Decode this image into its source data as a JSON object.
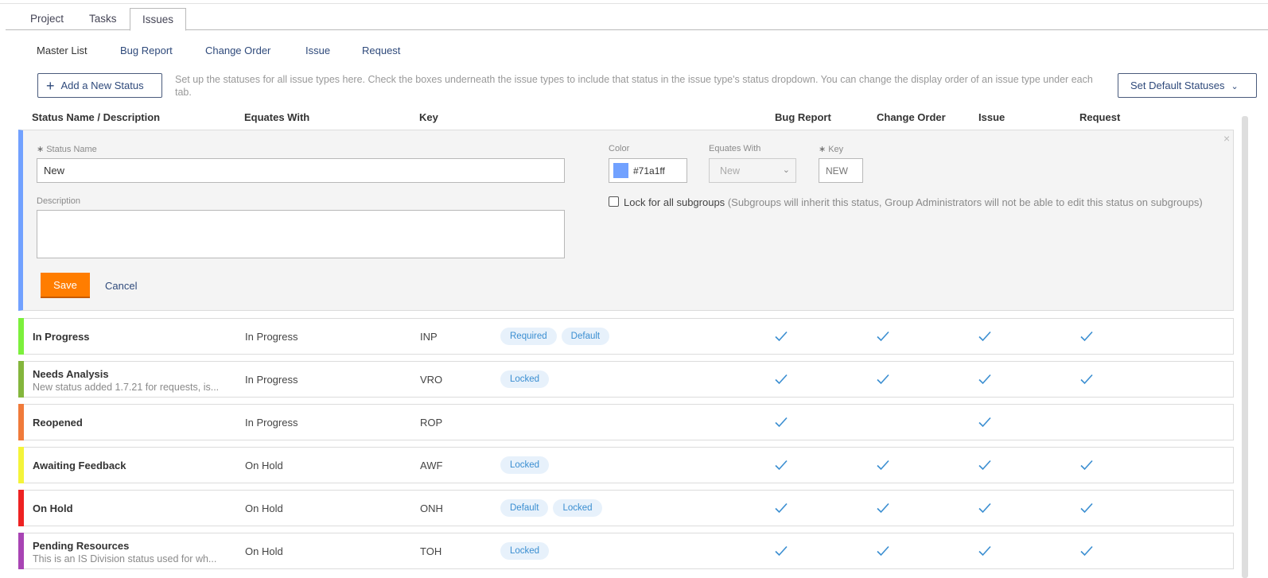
{
  "tabs": [
    "Project",
    "Tasks",
    "Issues"
  ],
  "active_tab": "Issues",
  "subnav": [
    "Master List",
    "Bug Report",
    "Change Order",
    "Issue",
    "Request"
  ],
  "add_status_label": "Add a New Status",
  "help_text": "Set up the statuses for all issue types here. Check the boxes underneath the issue types to include that status in the issue type's status dropdown. You can change the display order of an issue type under each tab.",
  "default_statuses_label": "Set Default Statuses",
  "columns": {
    "name": "Status Name / Description",
    "equates": "Equates With",
    "key": "Key",
    "bug_report": "Bug Report",
    "change_order": "Change Order",
    "issue": "Issue",
    "request": "Request"
  },
  "edit_form": {
    "status_name_label": "Status Name",
    "status_name_value": "New",
    "description_label": "Description",
    "description_value": "",
    "color_label": "Color",
    "color_value": "#71a1ff",
    "equates_label": "Equates With",
    "equates_value": "New",
    "key_label": "Key",
    "key_placeholder": "NEW",
    "lock_label": "Lock for all subgroups",
    "lock_sub": "(Subgroups will inherit this status, Group Administrators will not be able to edit this status on subgroups)",
    "lock_checked": false,
    "save_label": "Save",
    "cancel_label": "Cancel",
    "close_symbol": "×",
    "required_mark": "∗"
  },
  "rows": [
    {
      "name": "In Progress",
      "description": "",
      "equates": "In Progress",
      "key": "INP",
      "color": "#7cf03c",
      "badges": [
        "Required",
        "Default"
      ],
      "checks": [
        true,
        true,
        true,
        true
      ]
    },
    {
      "name": "Needs Analysis",
      "description": "New status added 1.7.21 for requests, is...",
      "equates": "In Progress",
      "key": "VRO",
      "color": "#84b63c",
      "badges": [
        "Locked"
      ],
      "checks": [
        true,
        true,
        true,
        true
      ]
    },
    {
      "name": "Reopened",
      "description": "",
      "equates": "In Progress",
      "key": "ROP",
      "color": "#f07a3a",
      "badges": [],
      "checks": [
        true,
        false,
        true,
        false
      ]
    },
    {
      "name": "Awaiting Feedback",
      "description": "",
      "equates": "On Hold",
      "key": "AWF",
      "color": "#f4f43a",
      "badges": [
        "Locked"
      ],
      "checks": [
        true,
        true,
        true,
        true
      ]
    },
    {
      "name": "On Hold",
      "description": "",
      "equates": "On Hold",
      "key": "ONH",
      "color": "#ee2222",
      "badges": [
        "Default",
        "Locked"
      ],
      "checks": [
        true,
        true,
        true,
        true
      ]
    },
    {
      "name": "Pending Resources",
      "description": "This is an IS Division status used for wh...",
      "equates": "On Hold",
      "key": "TOH",
      "color": "#a844b4",
      "badges": [
        "Locked"
      ],
      "checks": [
        true,
        true,
        true,
        true
      ]
    }
  ]
}
